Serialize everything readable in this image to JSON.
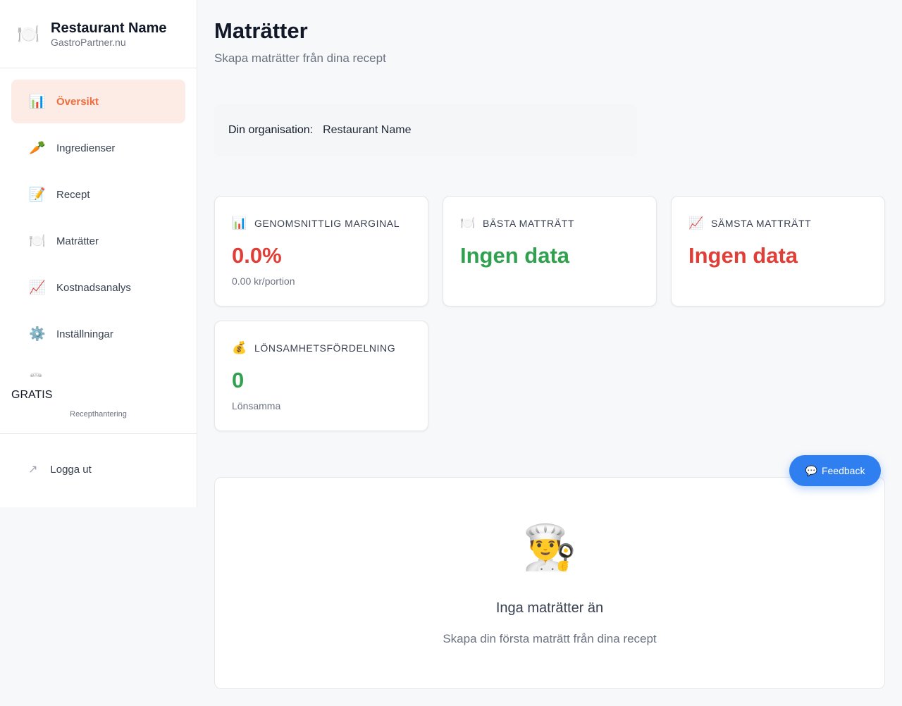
{
  "brand": {
    "icon": "🍽️",
    "title": "Restaurant Name",
    "subtitle": "GastroPartner.nu"
  },
  "nav": [
    {
      "icon": "📊",
      "label": "Översikt",
      "active": true
    },
    {
      "icon": "🥕",
      "label": "Ingredienser"
    },
    {
      "icon": "📝",
      "label": "Recept"
    },
    {
      "icon": "🍽️",
      "label": "Maträtter"
    },
    {
      "icon": "📈",
      "label": "Kostnadsanalys"
    },
    {
      "icon": "⚙️",
      "label": "Inställningar"
    },
    {
      "icon": "👩‍🍳",
      "label": ""
    }
  ],
  "plan": {
    "name": "GRATIS",
    "description": "Recepthantering"
  },
  "logout": {
    "icon": "↗",
    "label": "Logga ut"
  },
  "page": {
    "title": "Maträtter",
    "subtitle": "Skapa maträtter från dina recept"
  },
  "org": {
    "label": "Din organisation:",
    "value": "Restaurant Name"
  },
  "cards": [
    {
      "icon": "📊",
      "title": "GENOMSNITTLIG MARGINAL",
      "value": "0.0%",
      "note": "0.00 kr/portion",
      "value_color": "#e03e36"
    },
    {
      "icon": "🍽️",
      "title": "BÄSTA MATTRÄTT",
      "value": "Ingen data",
      "note": "",
      "value_color": "#30a14e"
    },
    {
      "icon": "📈",
      "title": "SÄMSTA MATTRÄTT",
      "value": "Ingen data",
      "note": "",
      "value_color": "#e03e36"
    },
    {
      "icon": "💰",
      "title": "LÖNSAMHETSFÖRDELNING",
      "value": "0",
      "note": "Lönsamma",
      "value_color": "#30a14e"
    }
  ],
  "feedback": {
    "icon": "💬",
    "label": "Feedback"
  },
  "empty": {
    "icon": "👨‍🍳",
    "title": "Inga maträtter än",
    "subtitle": "Skapa din första maträtt från dina recept"
  }
}
